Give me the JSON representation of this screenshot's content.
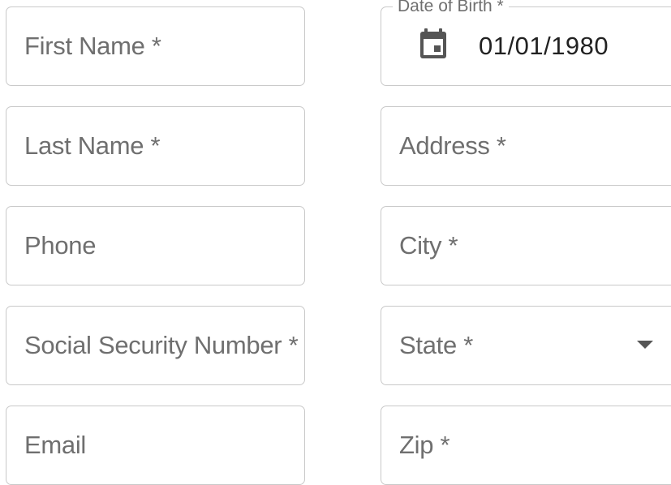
{
  "form": {
    "first_name": {
      "placeholder": "First Name *"
    },
    "last_name": {
      "placeholder": "Last Name *"
    },
    "phone": {
      "placeholder": "Phone"
    },
    "ssn": {
      "placeholder": "Social Security Number *"
    },
    "email": {
      "placeholder": "Email"
    },
    "dob": {
      "label": "Date of Birth *",
      "value": "01/01/1980",
      "icon": "calendar-icon"
    },
    "address": {
      "placeholder": "Address *"
    },
    "city": {
      "placeholder": "City *"
    },
    "state": {
      "placeholder": "State *",
      "icon": "dropdown-arrow-icon"
    },
    "zip": {
      "placeholder": "Zip *"
    }
  },
  "colors": {
    "border": "#c9c9c9",
    "placeholder_text": "#6f6f6f",
    "value_text": "#222222",
    "icon": "#555555"
  }
}
